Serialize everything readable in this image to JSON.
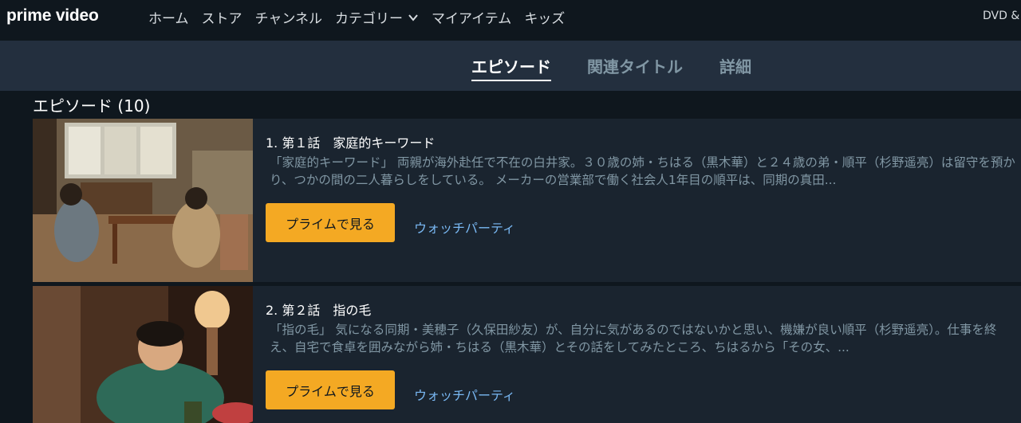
{
  "nav": {
    "logo": "prime video",
    "items": [
      "ホーム",
      "ストア",
      "チャンネル",
      "カテゴリー",
      "マイアイテム",
      "キッズ"
    ],
    "dvd": "DVD &"
  },
  "tabs": [
    "エピソード",
    "関連タイトル",
    "詳細"
  ],
  "section_title": "エピソード (10)",
  "episodes": [
    {
      "title": "1. 第１話　家庭的キーワード",
      "description": "「家庭的キーワード」 両親が海外赴任で不在の白井家。３０歳の姉・ちはる（黒木華）と２４歳の弟・順平（杉野遥亮）は留守を預かり、つかの間の二人暮らしをしている。 メーカーの営業部で働く社会人1年目の順平は、同期の真田...",
      "play_label": "プライムで見る",
      "watch_label": "ウォッチパーティ"
    },
    {
      "title": "2. 第２話　指の毛",
      "description": "「指の毛」 気になる同期・美穂子（久保田紗友）が、自分に気があるのではないかと思い、機嫌が良い順平（杉野遥亮）。仕事を終え、自宅で食卓を囲みながら姉・ちはる（黒木華）とその話をしてみたところ、ちはるから「その女、...",
      "play_label": "プライムで見る",
      "watch_label": "ウォッチパーティ"
    }
  ],
  "colors": {
    "background": "#0f171e",
    "tabbar": "#232f3e",
    "card": "#1a242f",
    "play_button": "#f4a923",
    "link": "#79b8f3",
    "muted_text": "#8197a4"
  }
}
